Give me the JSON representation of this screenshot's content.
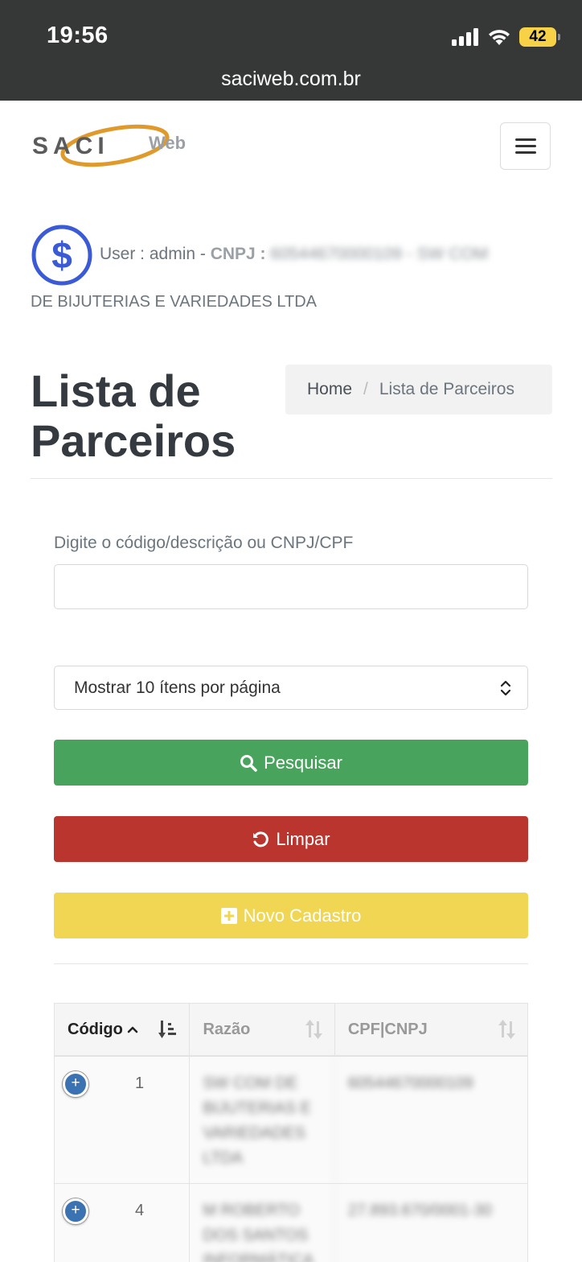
{
  "status_bar": {
    "time": "19:56",
    "battery": "42",
    "url": "saciweb.com.br"
  },
  "nav": {
    "logo_text": "SACI",
    "logo_suffix": "Web",
    "menu_icon": "hamburger-icon"
  },
  "user": {
    "prefix": "User : admin - ",
    "cnpj_label": "CNPJ : ",
    "cnpj_value": "60544670000109",
    "company_part1": " - SW COM",
    "company_part2": "DE BIJUTERIAS E VARIEDADES LTDA",
    "icon": "dollar-icon"
  },
  "page": {
    "title": "Lista de Parceiros",
    "breadcrumb": {
      "home": "Home",
      "sep": "/",
      "current": "Lista de Parceiros"
    }
  },
  "search": {
    "label": "Digite o código/descrição ou CNPJ/CPF",
    "value": ""
  },
  "page_size": {
    "selected": "Mostrar 10 ítens por página"
  },
  "buttons": {
    "search": "Pesquisar",
    "clear": "Limpar",
    "new": "Novo Cadastro"
  },
  "colors": {
    "green": "#48a45c",
    "red": "#b9352e",
    "yellow": "#f1d653",
    "accent_blue": "#3b5bd6"
  },
  "table": {
    "headers": [
      "Código",
      "Razão",
      "CPF|CNPJ"
    ],
    "rows": [
      {
        "code": "1",
        "razao": "SW COM DE BIJUTERIAS E VARIEDADES LTDA",
        "doc": "60544670000109"
      },
      {
        "code": "4",
        "razao": "M ROBERTO DOS SANTOS INFORMÁTICA",
        "doc": "27.893.670/0001-30"
      }
    ]
  }
}
